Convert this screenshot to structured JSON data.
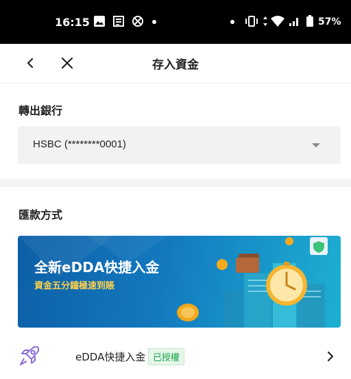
{
  "status_bar": {
    "time": "16:15",
    "battery": "57%"
  },
  "nav": {
    "title": "存入資金"
  },
  "transfer_bank": {
    "section_title": "轉出銀行",
    "selected_value": "HSBC (********0001)"
  },
  "remittance": {
    "section_title": "匯款方式",
    "banner": {
      "headline": "全新eDDA快捷入金",
      "subline": "資金五分鐘極速到賬"
    },
    "methods": [
      {
        "label": "eDDA快捷入金",
        "badge": "已授權",
        "icon": "rocket-icon"
      }
    ]
  },
  "colors": {
    "accent_green": "#1aa34a",
    "banner_blue": "#1379bf",
    "banner_yellow": "#ffd24a"
  }
}
